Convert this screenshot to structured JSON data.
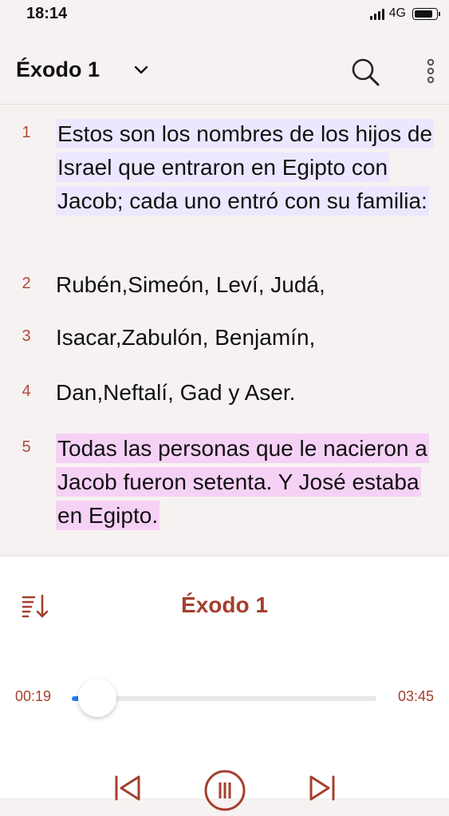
{
  "status": {
    "time": "18:14",
    "network": "4G",
    "battery": 0.85
  },
  "header": {
    "title": "Éxodo 1"
  },
  "verses": [
    {
      "num": "1",
      "text": "Estos son los nombres de los hijos de Israel que entraron en Egipto con Jacob; cada uno entró con su familia:",
      "highlight": "blue"
    },
    {
      "num": "2",
      "text": "Rubén,Simeón, Leví, Judá,",
      "highlight": "none"
    },
    {
      "num": "3",
      "text": "Isacar,Zabulón, Benjamín,",
      "highlight": "none"
    },
    {
      "num": "4",
      "text": "Dan,Neftalí, Gad y Aser.",
      "highlight": "none"
    },
    {
      "num": "5",
      "text": "Todas las personas que le nacieron a Jacob fueron setenta. Y José estaba en Egipto.",
      "highlight": "pink"
    }
  ],
  "player": {
    "title": "Éxodo 1",
    "elapsed": "00:19",
    "total": "03:45",
    "progress": 0.084
  },
  "colors": {
    "accent": "#a43f2e",
    "verse_number": "#b04a3a",
    "highlight_blue": "#ece7ff",
    "highlight_pink": "#f6d1f6",
    "progress": "#2a7cf0"
  },
  "icons": {
    "chevron": "chevron-down-icon",
    "search": "search-icon",
    "more": "more-vertical-icon",
    "playlist": "playlist-sort-icon",
    "previous": "skip-previous-icon",
    "pause": "pause-icon",
    "next": "skip-next-icon"
  }
}
